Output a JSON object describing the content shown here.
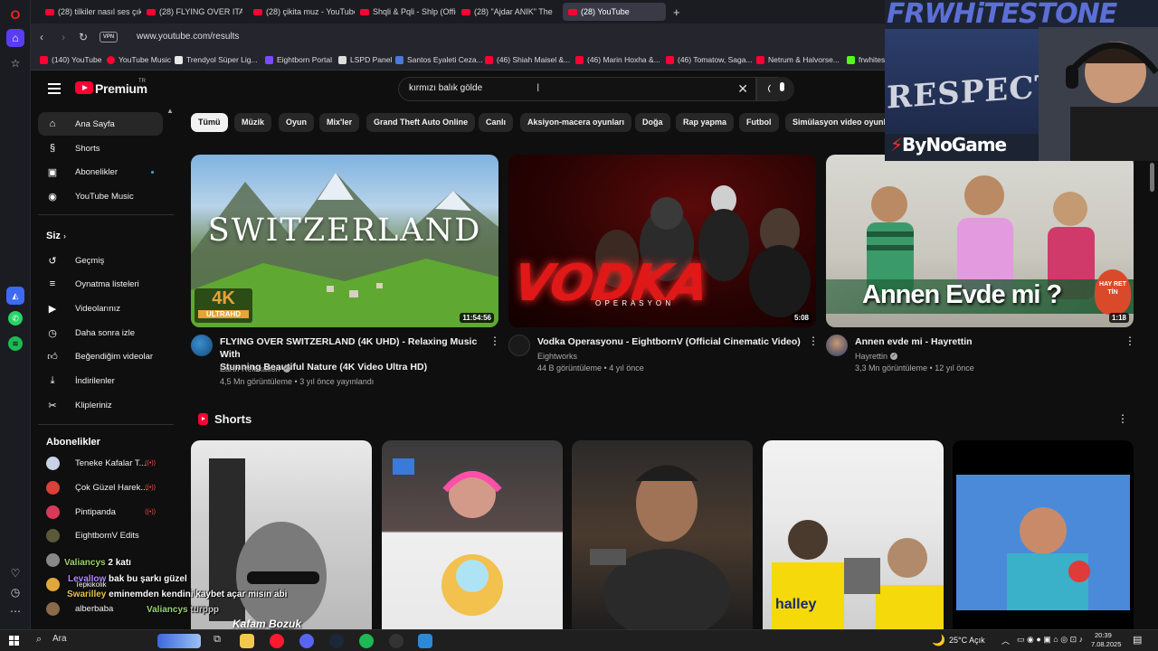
{
  "browser": {
    "tabs": [
      {
        "label": "(28) tilkiler nasıl ses çıkarır",
        "active": false
      },
      {
        "label": "(28) FLYING OVER ITALY (4",
        "active": false
      },
      {
        "label": "(28) çikita muz - YouTube",
        "active": false
      },
      {
        "label": "Shqli & Pqli - Shlp (Officia",
        "active": false
      },
      {
        "label": "(28) \"Ajdar ANIK\" The",
        "active": false
      },
      {
        "label": "(28) YouTube",
        "active": true
      }
    ],
    "new_tab": "+",
    "vpn": "VPN",
    "url": "www.youtube.com/results",
    "bookmarks": [
      {
        "label": "(140) YouTube",
        "color": "#ff0033"
      },
      {
        "label": "YouTube Music",
        "color": "#ff0033"
      },
      {
        "label": "Trendyol Süper Lig...",
        "color": "#e8e8e8"
      },
      {
        "label": "Eightborn Portal",
        "color": "#7b4bff"
      },
      {
        "label": "LSPD Panel",
        "color": "#dddddd"
      },
      {
        "label": "Santos Eyaleti Ceza...",
        "color": "#4a7bd6"
      },
      {
        "label": "(46) Shiah Maisel &...",
        "color": "#ff0033"
      },
      {
        "label": "(46) Marin Hoxha &...",
        "color": "#ff0033"
      },
      {
        "label": "(46) Tomatow, Saga...",
        "color": "#ff0033"
      },
      {
        "label": "Netrum & Halvorse...",
        "color": "#ff0033"
      },
      {
        "label": "frwhites",
        "color": "#53fc18"
      }
    ]
  },
  "youtube": {
    "brand": "Premium",
    "brand_tm": "TR",
    "search_query": "kırmızı balık gölde",
    "sidebar": {
      "main": [
        {
          "label": "Ana Sayfa",
          "icon": "home-icon"
        },
        {
          "label": "Shorts",
          "icon": "shorts-icon"
        },
        {
          "label": "Abonelikler",
          "icon": "subscriptions-icon"
        },
        {
          "label": "YouTube Music",
          "icon": "youtube-music-icon"
        }
      ],
      "you_heading": "Siz",
      "you": [
        {
          "label": "Geçmiş",
          "icon": "history-icon"
        },
        {
          "label": "Oynatma listeleri",
          "icon": "playlists-icon"
        },
        {
          "label": "Videolarınız",
          "icon": "your-videos-icon"
        },
        {
          "label": "Daha sonra izle",
          "icon": "watch-later-icon"
        },
        {
          "label": "Beğendiğim videolar",
          "icon": "liked-icon"
        },
        {
          "label": "İndirilenler",
          "icon": "downloads-icon"
        },
        {
          "label": "Klipleriniz",
          "icon": "clips-icon"
        }
      ],
      "subs_heading": "Abonelikler",
      "subs": [
        {
          "label": "Teneke Kafalar T...",
          "color": "#c9d3e8",
          "live": true
        },
        {
          "label": "Çok Güzel Harek...",
          "color": "#d9413a",
          "live": true
        },
        {
          "label": "Pintipanda",
          "color": "#d93a5a",
          "live": true
        },
        {
          "label": "EightbornV Edits",
          "color": "#5a5a3a",
          "live": false
        },
        {
          "label": "...",
          "color": "#888888",
          "live": false
        },
        {
          "label": "Tepkikolik",
          "color": "#e0a83a",
          "live": false
        },
        {
          "label": "alberbaba",
          "color": "#8a6a4a",
          "live": false
        }
      ]
    },
    "chips": [
      "Tümü",
      "Müzik",
      "Oyun",
      "Mix'ler",
      "Grand Theft Auto Online",
      "Canlı",
      "Aksiyon-macera oyunları",
      "Doğa",
      "Rap yapma",
      "Futbol",
      "Simülasyon video oyunları"
    ],
    "videos": [
      {
        "thumb_text": "SWITZERLAND",
        "badge": "4K",
        "badge_sub": "ULTRAHD",
        "duration": "11:54:56",
        "title_l1": "FLYING OVER SWITZERLAND (4K UHD) - Relaxing Music With",
        "title_l2": "Stunning Beautiful Nature (4K Video Ultra HD)",
        "channel": "Earth Relaxation",
        "meta": "4,5 Mn görüntüleme • 3 yıl önce yayınlandı"
      },
      {
        "thumb_text": "VODKA",
        "thumb_sub": "O P E R A S Y O N",
        "duration": "5:08",
        "title_l1": "Vodka Operasyonu - EightbornV (Official Cinematic Video)",
        "title_l2": "",
        "channel": "Eightworks",
        "meta": "44 B görüntüleme • 4 yıl önce"
      },
      {
        "thumb_text": "Annen Evde mi ?",
        "thumb_logo": "HAY RET TİN",
        "duration": "1:18",
        "title_l1": "Annen evde mi - Hayrettin",
        "title_l2": "",
        "channel": "Hayrettin",
        "meta": "3,3 Mn görüntüleme • 12 yıl önce"
      }
    ],
    "shorts_heading": "Shorts",
    "short_overlay_text": "Kafam Bozuk"
  },
  "webcam": {
    "title": "FRWHiTESTONE",
    "banner": "RESPECT",
    "sponsor": "ByNoGame"
  },
  "chat": [
    {
      "user": "Valiancys",
      "msg": "2 katı"
    },
    {
      "user": "LevalIow",
      "msg": "bak bu şarkı güzel"
    },
    {
      "user": "Swarilley",
      "msg": "eminemden kendini kaybet açar mısın abi"
    },
    {
      "user": "Valiancys",
      "msg": "turppp"
    }
  ],
  "taskbar": {
    "search": "Ara",
    "weather": "25°C  Açık",
    "time": "20:39",
    "date": "7.08.2025"
  }
}
